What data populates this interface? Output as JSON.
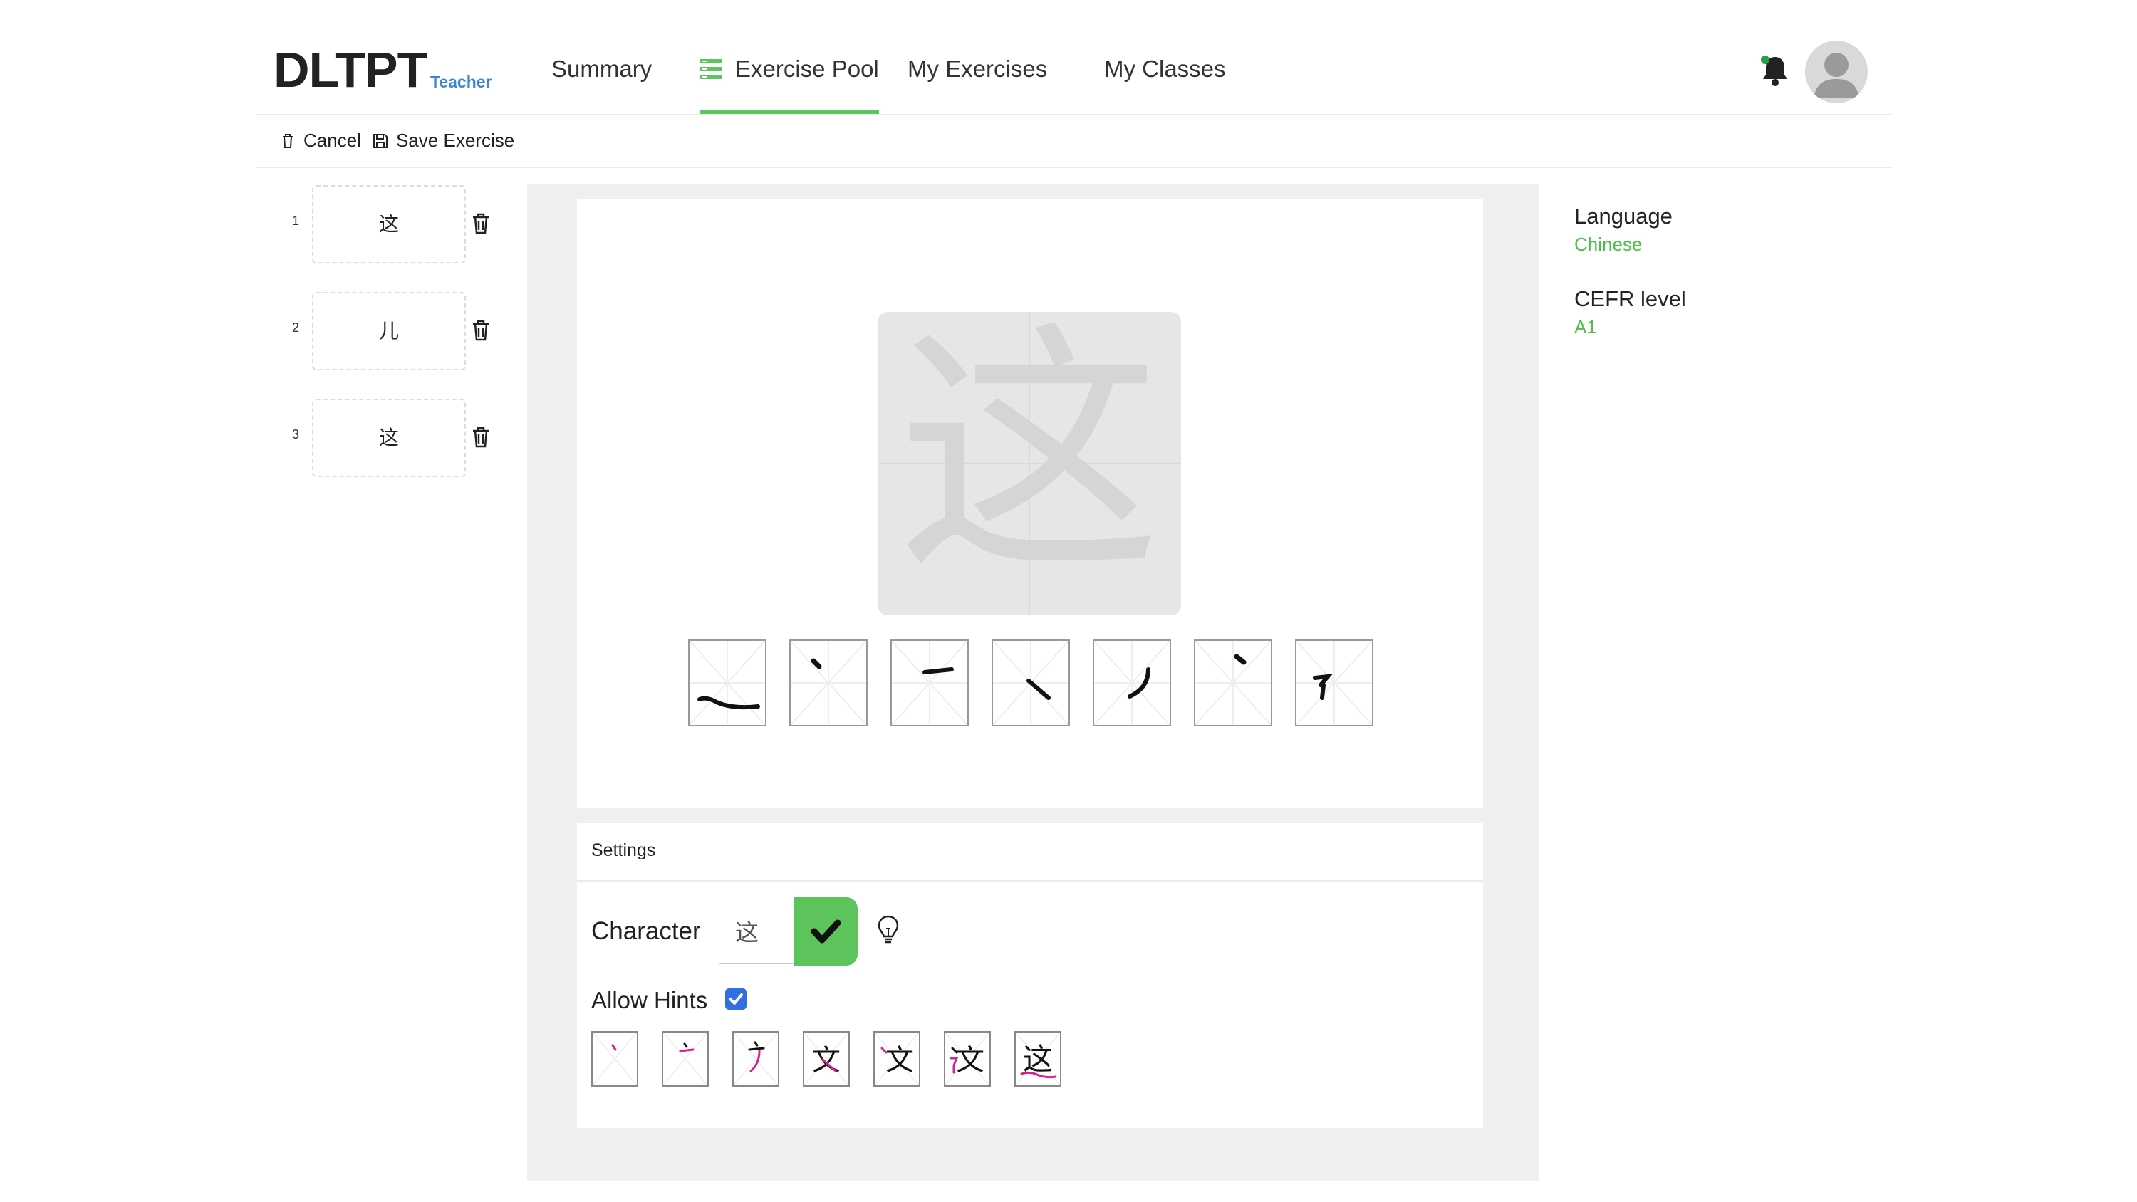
{
  "header": {
    "logo": "DLTPT",
    "role": "Teacher",
    "nav": [
      {
        "label": "Summary",
        "active": false
      },
      {
        "label": "Exercise Pool",
        "active": true
      },
      {
        "label": "My Exercises",
        "active": false
      },
      {
        "label": "My Classes",
        "active": false
      }
    ],
    "bell_icon": "bell-icon",
    "avatar_icon": "user-avatar-icon"
  },
  "toolbar": {
    "cancel_label": "Cancel",
    "save_label": "Save Exercise"
  },
  "exercise_list": [
    {
      "number": "1",
      "character": "这"
    },
    {
      "number": "2",
      "character": "儿"
    },
    {
      "number": "3",
      "character": "这"
    }
  ],
  "canvas": {
    "character": "这",
    "stroke_count": 7
  },
  "settings": {
    "title": "Settings",
    "character_label": "Character",
    "character_value": "这",
    "allow_hints_label": "Allow Hints",
    "allow_hints_checked": true,
    "hint_steps": 7
  },
  "meta": {
    "language_label": "Language",
    "language_value": "Chinese",
    "cefr_label": "CEFR level",
    "cefr_value": "A1"
  },
  "colors": {
    "accent_green": "#5dc45b",
    "role_blue": "#3b86d6",
    "hint_magenta": "#d6248e"
  }
}
